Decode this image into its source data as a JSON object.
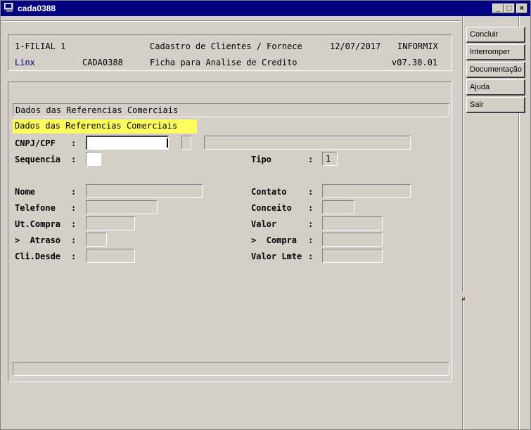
{
  "window": {
    "title": "cada0388"
  },
  "titlebar_buttons": {
    "minimize": "_",
    "maximize": "□",
    "close": "×"
  },
  "header": {
    "filial": "1-FILIAL 1",
    "module_title": "Cadastro de Clientes / Fornece",
    "date": "12/07/2017",
    "db": "INFORMIX",
    "brand": "Linx",
    "program": "CADA0388",
    "subtitle": "Ficha para Analise de Credito",
    "version": "v07.30.01"
  },
  "section": {
    "title": "Dados das Referencias Comerciais",
    "highlight": "Dados das Referencias Comerciais"
  },
  "form": {
    "cnpj_label": "CNPJ/CPF",
    "sequencia_label": "Sequencia",
    "tipo_label": "Tipo",
    "tipo_value": "1",
    "nome_label": "Nome",
    "contato_label": "Contato",
    "telefone_label": "Telefone",
    "conceito_label": "Conceito",
    "ut_compra_label": "Ut.Compra",
    "valor_label": "Valor",
    "atraso_label": ">  Atraso",
    "compra_label": ">  Compra",
    "cli_desde_label": "Cli.Desde",
    "valor_lmte_label": "Valor Lmte",
    "colon": ":"
  },
  "sidebar": {
    "buttons": [
      "Concluir",
      "Interromper",
      "Documentação",
      "Ajuda",
      "Sair"
    ]
  },
  "colors": {
    "titlebar": "#000080",
    "highlight": "#ffff60",
    "brand": "#000080",
    "face": "#d4d0c8"
  }
}
